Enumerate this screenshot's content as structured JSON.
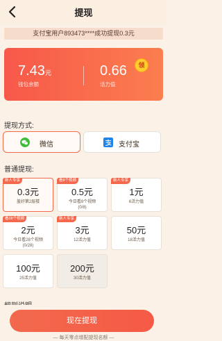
{
  "header": {
    "title": "提现"
  },
  "notice": "支付宝用户893473****成功提现0.3元",
  "balance": {
    "wallet_amount": "7.43",
    "wallet_unit": "元",
    "wallet_label": "钱包余额",
    "vitality_amount": "0.66",
    "vitality_label": "活力值",
    "badge": "领"
  },
  "method_section": {
    "title": "提现方式:",
    "methods": [
      {
        "label": "微信",
        "selected": true,
        "icon": "wechat-icon"
      },
      {
        "label": "支付宝",
        "selected": false,
        "icon": "alipay-icon"
      }
    ]
  },
  "normal_section": {
    "title": "普通提现:",
    "tiles": [
      {
        "tag": "新人专享",
        "amount": "0.3元",
        "desc": "盖好第2层楼",
        "desc2": ""
      },
      {
        "tag": "看8个视频",
        "amount": "0.5元",
        "desc": "今日看8个视频",
        "desc2": "(0/8)"
      },
      {
        "tag": "新人专享",
        "amount": "1元",
        "desc": "6活力值",
        "desc2": ""
      },
      {
        "tag": "看28个视频",
        "amount": "2元",
        "desc": "今日看28个视频",
        "desc2": "(0/28)"
      },
      {
        "tag": "新人专享",
        "amount": "3元",
        "desc": "12活力值",
        "desc2": ""
      },
      {
        "tag": "",
        "amount": "50元",
        "desc": "18活力值",
        "desc2": ""
      },
      {
        "tag": "",
        "amount": "100元",
        "desc": "25活力值",
        "desc2": ""
      },
      {
        "tag": "",
        "amount": "200元",
        "desc": "30活力值",
        "desc2": ""
      }
    ]
  },
  "rules_title": "规则说明",
  "withdraw_button": "现在提现",
  "footer": "— 每天零点增配提现名额 —",
  "colors": {
    "accent": "#f2694e",
    "wechat": "#3fba3a",
    "alipay": "#1f84e8"
  }
}
